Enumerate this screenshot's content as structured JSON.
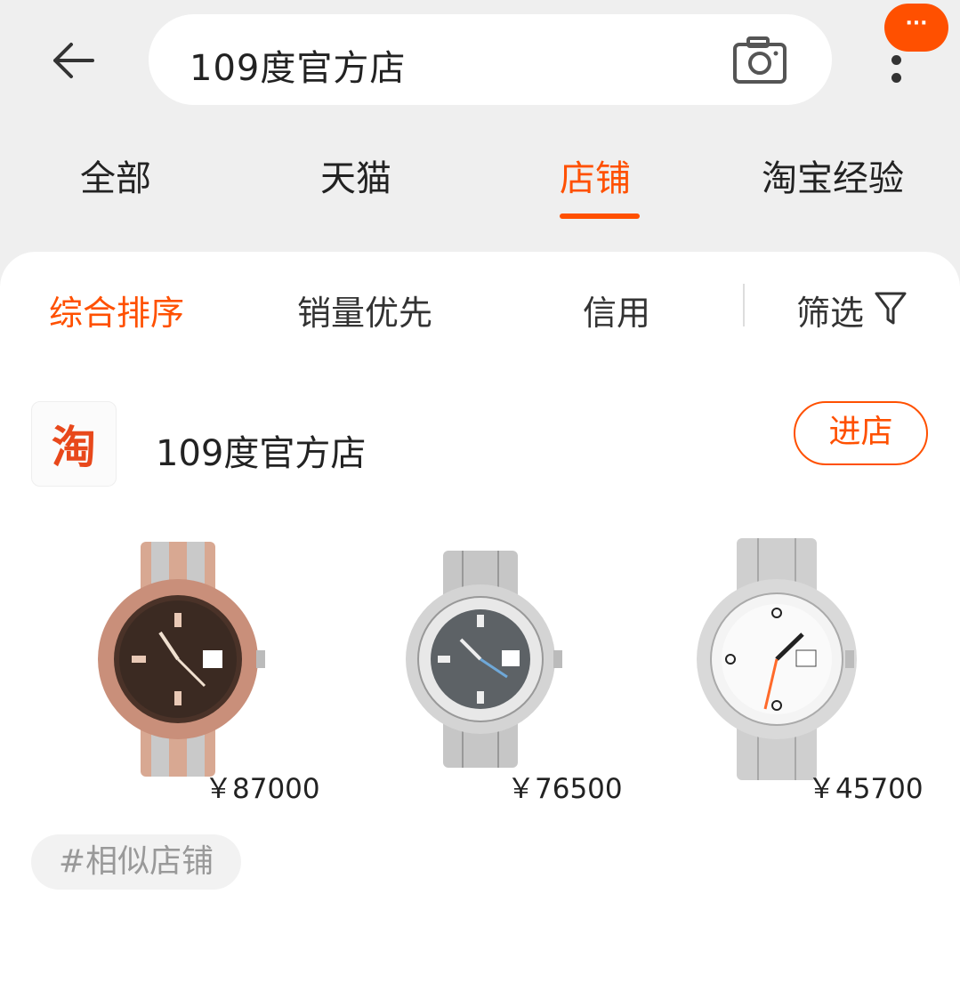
{
  "header": {
    "search_text": "109度官方店",
    "badge": "···"
  },
  "tabs": [
    {
      "label": "全部"
    },
    {
      "label": "天猫"
    },
    {
      "label": "店铺"
    },
    {
      "label": "淘宝经验"
    }
  ],
  "sort": {
    "items": [
      {
        "label": "综合排序"
      },
      {
        "label": "销量优先"
      },
      {
        "label": "信用"
      }
    ],
    "filter_label": "筛选"
  },
  "shop": {
    "logo_text": "淘",
    "name": "109度官方店",
    "enter_label": "进店",
    "products": [
      {
        "price": "￥87000"
      },
      {
        "price": "￥76500"
      },
      {
        "price": "￥45700"
      }
    ]
  },
  "similar_tag": "#相似店铺",
  "colors": {
    "accent": "#ff5000",
    "background": "#efefef"
  }
}
